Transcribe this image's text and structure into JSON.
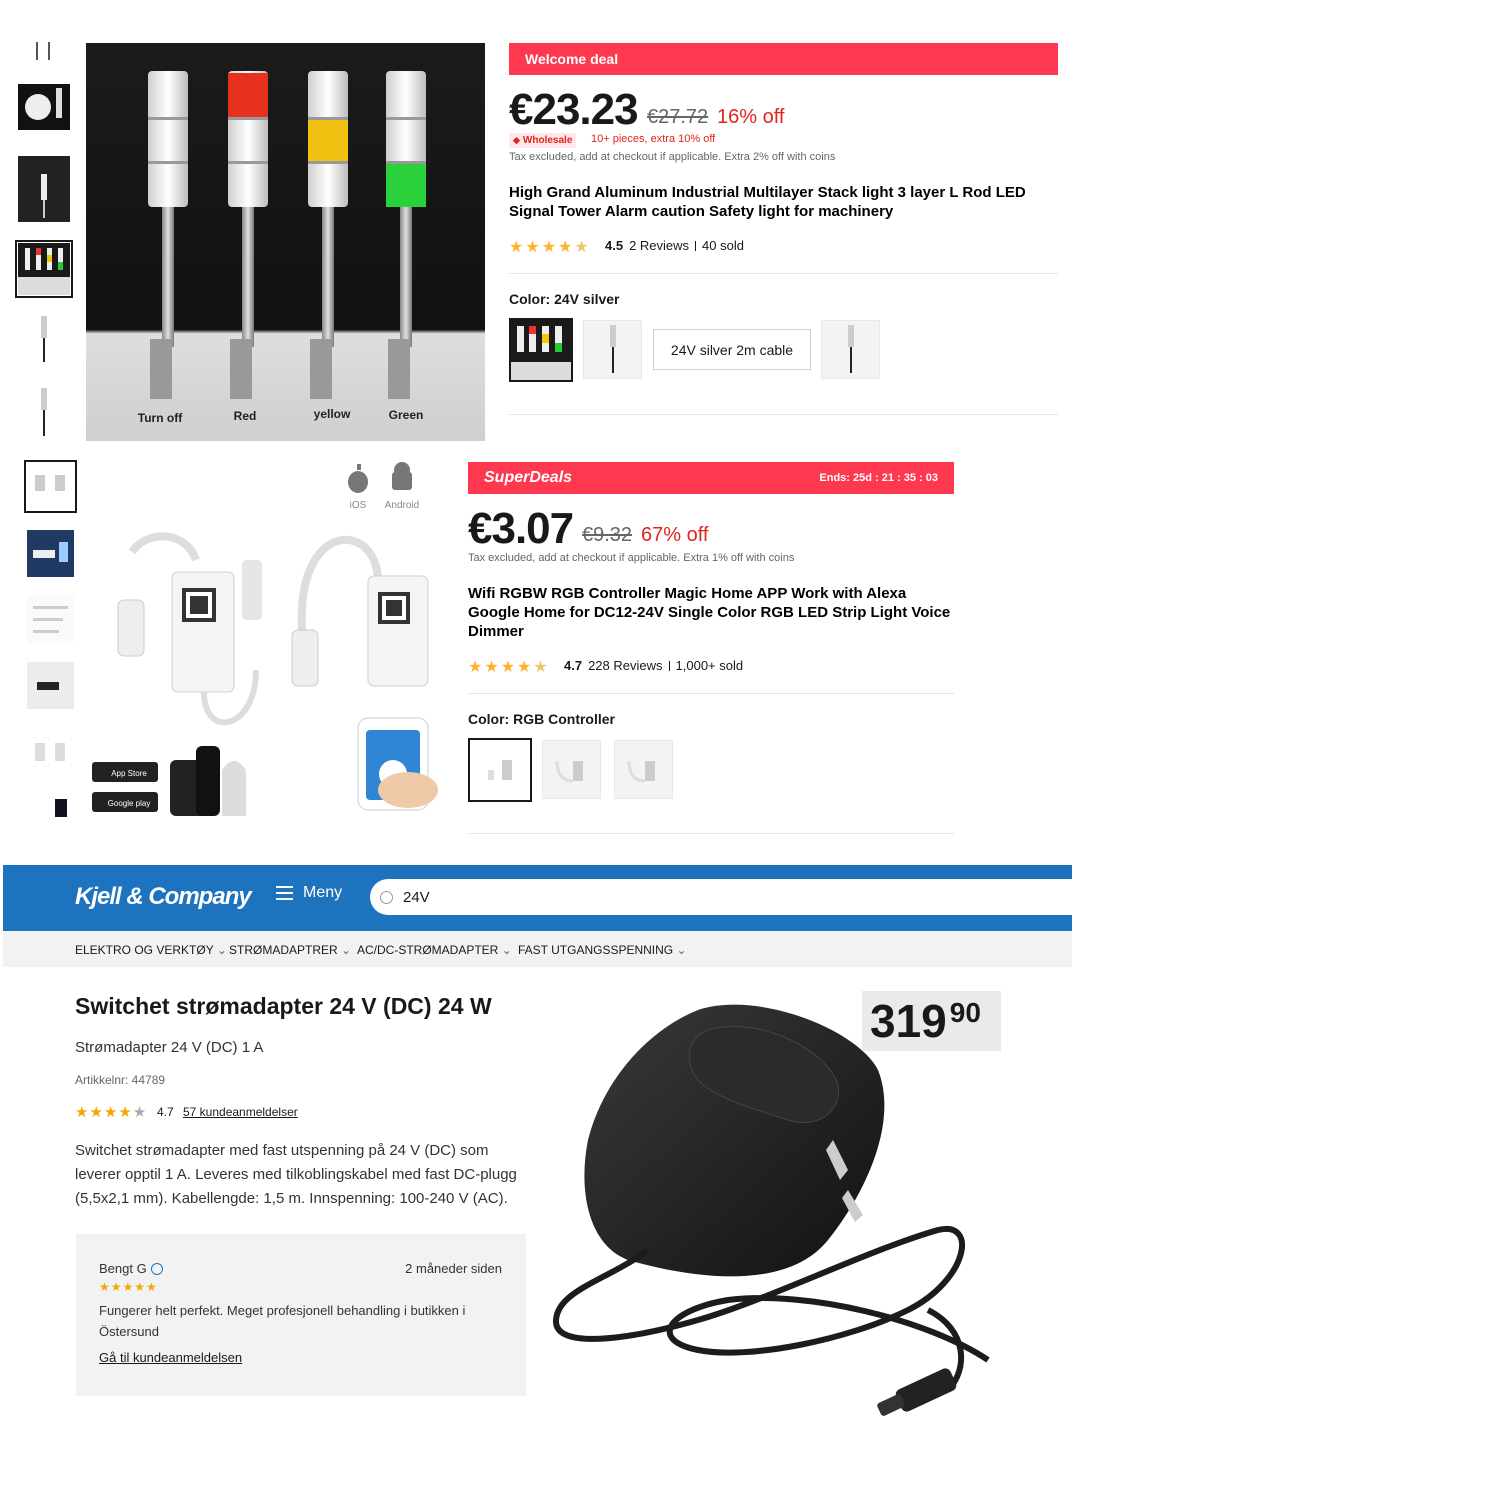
{
  "p1": {
    "banner": "Welcome deal",
    "price": "€23.23",
    "old_price": "€27.72",
    "discount": "16% off",
    "wholesale_badge": "Wholesale",
    "wholesale_text": "10+ pieces, extra 10% off",
    "tax_note": "Tax excluded, add at checkout if applicable. Extra 2% off with coins",
    "title": "High Grand Aluminum Industrial Multilayer Stack light 3 layer L Rod LED Signal Tower Alarm caution Safety light for machinery",
    "rating": "4.5",
    "stars": 4.5,
    "reviews": "2 Reviews",
    "sold": "40 sold",
    "color_label": "Color: 24V silver",
    "text_option": "24V silver 2m cable",
    "image_labels": [
      "Turn off",
      "Red",
      "yellow",
      "Green"
    ]
  },
  "p2": {
    "brand": "SuperDeals",
    "ends": "Ends: 25d : 21 : 35 : 03",
    "price": "€3.07",
    "old_price": "€9.32",
    "discount": "67% off",
    "tax_note": "Tax excluded, add at checkout if applicable. Extra 1% off with coins",
    "title": "Wifi RGBW RGB Controller Magic Home APP Work with Alexa Google Home for DC12-24V Single Color RGB LED Strip Light Voice Dimmer",
    "rating": "4.7",
    "stars": 4.7,
    "reviews": "228 Reviews",
    "sold": "1,000+ sold",
    "color_label": "Color: RGB Controller",
    "image_labels": [
      "iOS",
      "Android",
      "App Store",
      "Google play"
    ]
  },
  "kjell": {
    "logo": "Kjell & Company",
    "menu": "Meny",
    "search_value": "24V",
    "breadcrumb": [
      "ELEKTRO OG VERKTØY",
      "STRØMADAPTRER",
      "AC/DC-STRØMADAPTER",
      "FAST UTGANGSSPENNING"
    ],
    "title": "Switchet strømadapter 24 V (DC) 24 W",
    "subtitle": "Strømadapter 24 V (DC) 1 A",
    "article": "Artikkelnr: 44789",
    "rating": "4.7",
    "reviews_link": "57 kundeanmeldelser",
    "description": "Switchet strømadapter med fast utspenning på 24 V (DC) som leverer opptil 1 A. Leveres med tilkoblingskabel med fast DC-plugg (5,5x2,1 mm). Kabellengde: 1,5 m. Innspenning: 100-240 V (AC).",
    "price_main": "319",
    "price_dec": "90",
    "review": {
      "author": "Bengt G",
      "time": "2 måneder siden",
      "text": "Fungerer helt perfekt. Meget profesjonell behandling i butikken i Östersund",
      "link": "Gå til kundeanmeldelsen"
    }
  },
  "colors": {
    "accent_red": "#fd384f",
    "kjell_blue": "#1d73be",
    "star": "#fdb42a",
    "discount_red": "#e1251b"
  }
}
